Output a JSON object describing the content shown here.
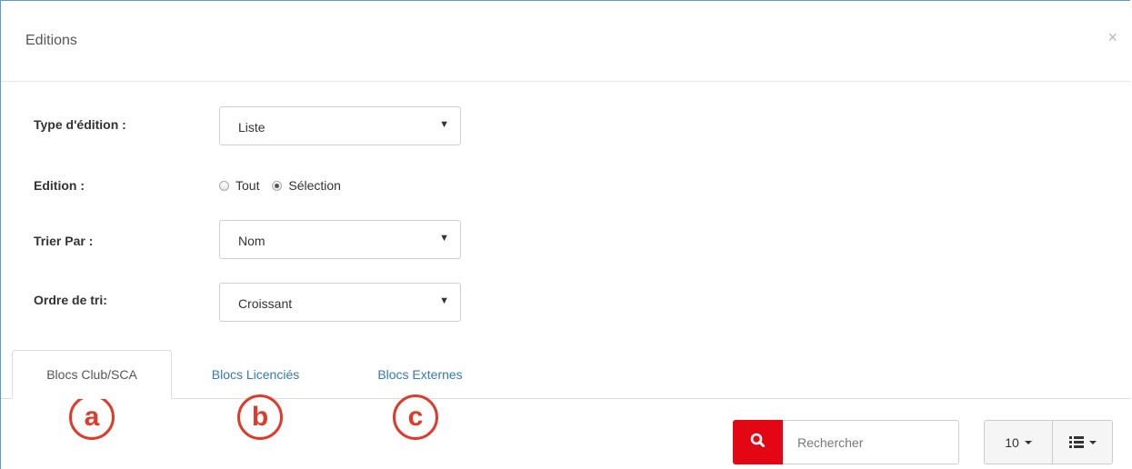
{
  "modal": {
    "title": "Editions",
    "close_icon": "×"
  },
  "form": {
    "type_label": "Type d'édition :",
    "type_value": "Liste",
    "edition_label": "Edition :",
    "edition_options": [
      "Tout",
      "Sélection"
    ],
    "edition_selected": "Sélection",
    "sort_by_label": "Trier Par :",
    "sort_by_value": "Nom",
    "sort_order_label": "Ordre de tri:",
    "sort_order_value": "Croissant"
  },
  "tabs": [
    {
      "label": "Blocs Club/SCA",
      "active": true
    },
    {
      "label": "Blocs Licenciés",
      "active": false
    },
    {
      "label": "Blocs Externes",
      "active": false
    }
  ],
  "markers": [
    "a",
    "b",
    "c"
  ],
  "toolbar": {
    "search_placeholder": "Rechercher",
    "page_size": "10",
    "search_icon": "search-icon",
    "view_icon": "list-icon"
  },
  "colors": {
    "accent_red": "#e30613",
    "link_blue": "#337ab7",
    "marker_red": "#e03a2b"
  }
}
